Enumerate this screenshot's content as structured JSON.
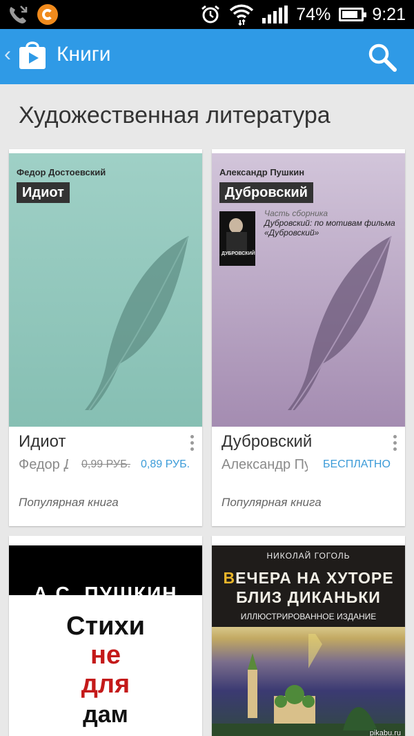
{
  "status_bar": {
    "battery": "74%",
    "time": "9:21"
  },
  "action_bar": {
    "title": "Книги"
  },
  "section": {
    "title": "Художественная литература"
  },
  "books": [
    {
      "cover_author": "Федор Достоевский",
      "cover_title": "Идиот",
      "title": "Идиот",
      "author": "Федор Достоевский",
      "old_price": "0,99 РУБ.",
      "price": "0,89 РУБ.",
      "tag": "Популярная книга",
      "cover_color": "#9fd0c6"
    },
    {
      "cover_author": "Александр Пушкин",
      "cover_title": "Дубровский",
      "part_of_label": "Часть сборника",
      "part_of_name": "Дубровский: по мотивам фильма «Дубровский»",
      "mini_cover_text": "ДУБРОВСКИЙ",
      "title": "Дубровский",
      "author": "Александр Пушкин",
      "price": "БЕСПЛАТНО",
      "tag": "Популярная книга",
      "cover_color": "#c6b6d2"
    },
    {
      "cover_author": "А.С. ПУШКИН",
      "cover_lines": [
        "Стихи",
        "не",
        "для",
        "дам"
      ]
    },
    {
      "cover_author": "НИКОЛАЙ ГОГОЛЬ",
      "cover_title_line1_first": "В",
      "cover_title_line1_rest": "ЕЧЕРА НА ХУТОРЕ",
      "cover_title_line2": "БЛИЗ ДИКАНЬКИ",
      "cover_subtitle": "ИЛЛЮСТРИРОВАННОЕ ИЗДАНИЕ"
    }
  ],
  "watermark": "pikabu.ru",
  "colors": {
    "action_bar": "#2f9ae6",
    "link_price": "#3b9bd8",
    "background": "#e8e8e8"
  }
}
